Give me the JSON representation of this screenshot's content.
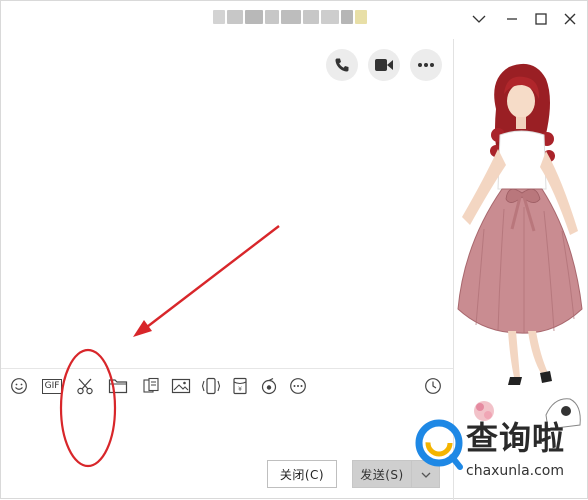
{
  "window": {
    "controls": {
      "chevron": "chevron-down-icon",
      "minimize": "minimize-icon",
      "maximize": "maximize-icon",
      "close": "close-icon"
    }
  },
  "header_actions": [
    "phone-icon",
    "video-call-icon",
    "more-icon"
  ],
  "toolbar": {
    "tools": [
      "emoji-icon",
      "gif-icon",
      "scissors-icon",
      "folder-icon",
      "doc-icon",
      "image-icon",
      "shake-icon",
      "red-packet-icon",
      "music-icon",
      "more-icon"
    ],
    "gif_label": "GIF",
    "history": "clock-icon"
  },
  "footer": {
    "close_label": "关闭(C)",
    "send_label": "发送(S)"
  },
  "watermark": {
    "brand": "查询啦",
    "domain": "chaxunla.com"
  },
  "colors": {
    "annotation_red": "#d8262a",
    "watermark_blue": "#1e88e5"
  }
}
